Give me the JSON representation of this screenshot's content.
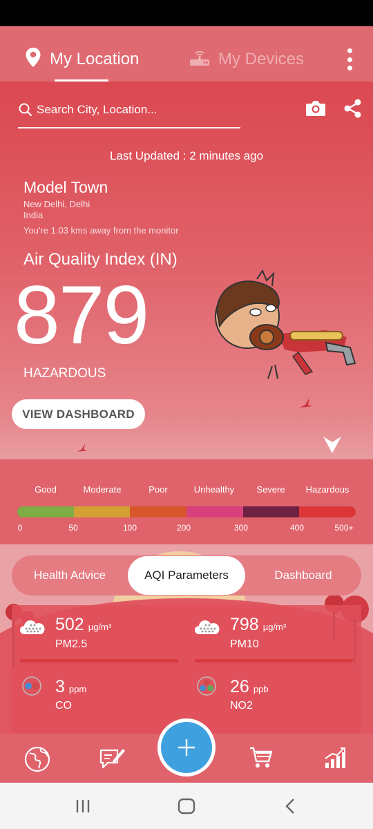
{
  "tabs": {
    "my_location": "My Location",
    "my_devices": "My Devices"
  },
  "search": {
    "placeholder": "Search City, Location..."
  },
  "last_updated": "Last Updated : 2 minutes ago",
  "location": {
    "name": "Model Town",
    "city": "New Delhi, Delhi",
    "country": "India",
    "distance": "You're 1.03 kms away from the monitor"
  },
  "aqi": {
    "title": "Air Quality Index (IN)",
    "value": "879",
    "status": "HAZARDOUS"
  },
  "view_dashboard": "VIEW DASHBOARD",
  "scale": {
    "labels": [
      "Good",
      "Moderate",
      "Poor",
      "Unhealthy",
      "Severe",
      "Hazardous"
    ],
    "numbers": [
      "0",
      "50",
      "100",
      "200",
      "300",
      "400",
      "500+"
    ],
    "colors": [
      "#7fac45",
      "#d4a034",
      "#d8562c",
      "#d8407c",
      "#6e2141",
      "#dc3636"
    ]
  },
  "segments": {
    "health_advice": "Health Advice",
    "aqi_parameters": "AQI Parameters",
    "dashboard": "Dashboard"
  },
  "params": [
    {
      "value": "502",
      "unit": "µg/m³",
      "name": "PM2.5",
      "icon": "cloud-dots-icon"
    },
    {
      "value": "798",
      "unit": "µg/m³",
      "name": "PM10",
      "icon": "cloud-dots-icon"
    },
    {
      "value": "3",
      "unit": "ppm",
      "name": "CO",
      "icon": "molecule-icon"
    },
    {
      "value": "26",
      "unit": "ppb",
      "name": "NO2",
      "icon": "molecule-icon"
    }
  ],
  "bottom_nav": [
    "globe-icon",
    "edit-note-icon",
    "add-icon",
    "cart-icon",
    "bar-chart-icon"
  ],
  "colors": {
    "accent": "#e0636b",
    "fab": "#3fa0e0",
    "tab_active": "#ffffff"
  }
}
